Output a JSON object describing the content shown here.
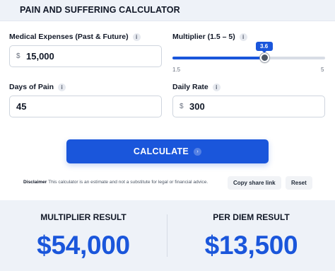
{
  "header": {
    "title": "PAIN AND SUFFERING CALCULATOR"
  },
  "fields": {
    "medical": {
      "label": "Medical Expenses (Past & Future)",
      "currency": "$",
      "value": "15,000"
    },
    "multiplier": {
      "label": "Multiplier (1.5 – 5)",
      "value": "3.6",
      "min_label": "1.5",
      "max_label": "5",
      "level": 0.6
    },
    "days": {
      "label": "Days of Pain",
      "value": "45"
    },
    "rate": {
      "label": "Daily Rate",
      "currency": "$",
      "value": "300"
    }
  },
  "icons": {
    "info": "i",
    "arrow": "›"
  },
  "actions": {
    "calculate": "CALCULATE",
    "share": "Copy share link",
    "reset": "Reset"
  },
  "disclaimer": {
    "label": "Disclaimer",
    "text": "This calculator is an estimate and not a substitute for legal or financial advice."
  },
  "results": {
    "multiplier": {
      "title": "MULTIPLIER RESULT",
      "value": "$54,000"
    },
    "per_diem": {
      "title": "PER DIEM RESULT",
      "value": "$13,500"
    }
  },
  "colors": {
    "accent": "#1a56db",
    "panel": "#eef2f8"
  }
}
